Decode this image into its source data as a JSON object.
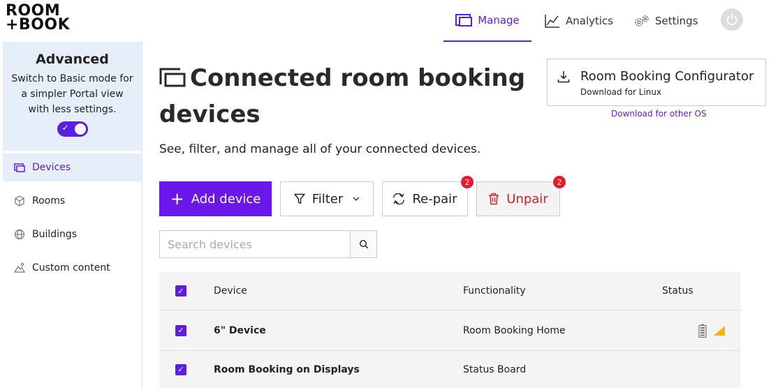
{
  "header": {
    "logo_line1": "ROOM",
    "logo_line2": "+BOOK",
    "nav": {
      "manage": "Manage",
      "analytics": "Analytics",
      "settings": "Settings"
    }
  },
  "sidebar": {
    "advanced": {
      "title": "Advanced",
      "description": "Switch to Basic mode for a simpler Portal view with less settings.",
      "toggle_on": true
    },
    "items": [
      {
        "label": "Devices",
        "icon": "devices-icon",
        "active": true
      },
      {
        "label": "Rooms",
        "icon": "rooms-icon",
        "active": false
      },
      {
        "label": "Buildings",
        "icon": "globe-icon",
        "active": false
      },
      {
        "label": "Custom content",
        "icon": "custom-content-icon",
        "active": false
      }
    ]
  },
  "main": {
    "title": "Connected room booking devices",
    "subtitle": "See, filter, and manage all of your connected devices.",
    "actions": {
      "add": "Add device",
      "filter": "Filter",
      "repair": "Re-pair",
      "repair_badge": "2",
      "unpair": "Unpair",
      "unpair_badge": "2"
    },
    "search": {
      "placeholder": "Search devices",
      "value": ""
    },
    "table": {
      "columns": [
        "Device",
        "Functionality",
        "Status"
      ],
      "rows": [
        {
          "device": "6\" Device",
          "functionality": "Room Booking Home",
          "status_icons": [
            "battery-icon",
            "warning-signal-icon"
          ]
        },
        {
          "device": "Room Booking on Displays",
          "functionality": "Status Board",
          "status_icons": []
        }
      ]
    }
  },
  "configurator": {
    "title": "Room Booking Configurator",
    "subtitle": "Download for Linux",
    "other_link": "Download for other OS"
  },
  "colors": {
    "accent": "#5b1fe0",
    "add_button": "#6a17ea",
    "danger": "#d41f2c",
    "badge": "#e8192c",
    "sidebar_highlight": "#e6eefa"
  }
}
